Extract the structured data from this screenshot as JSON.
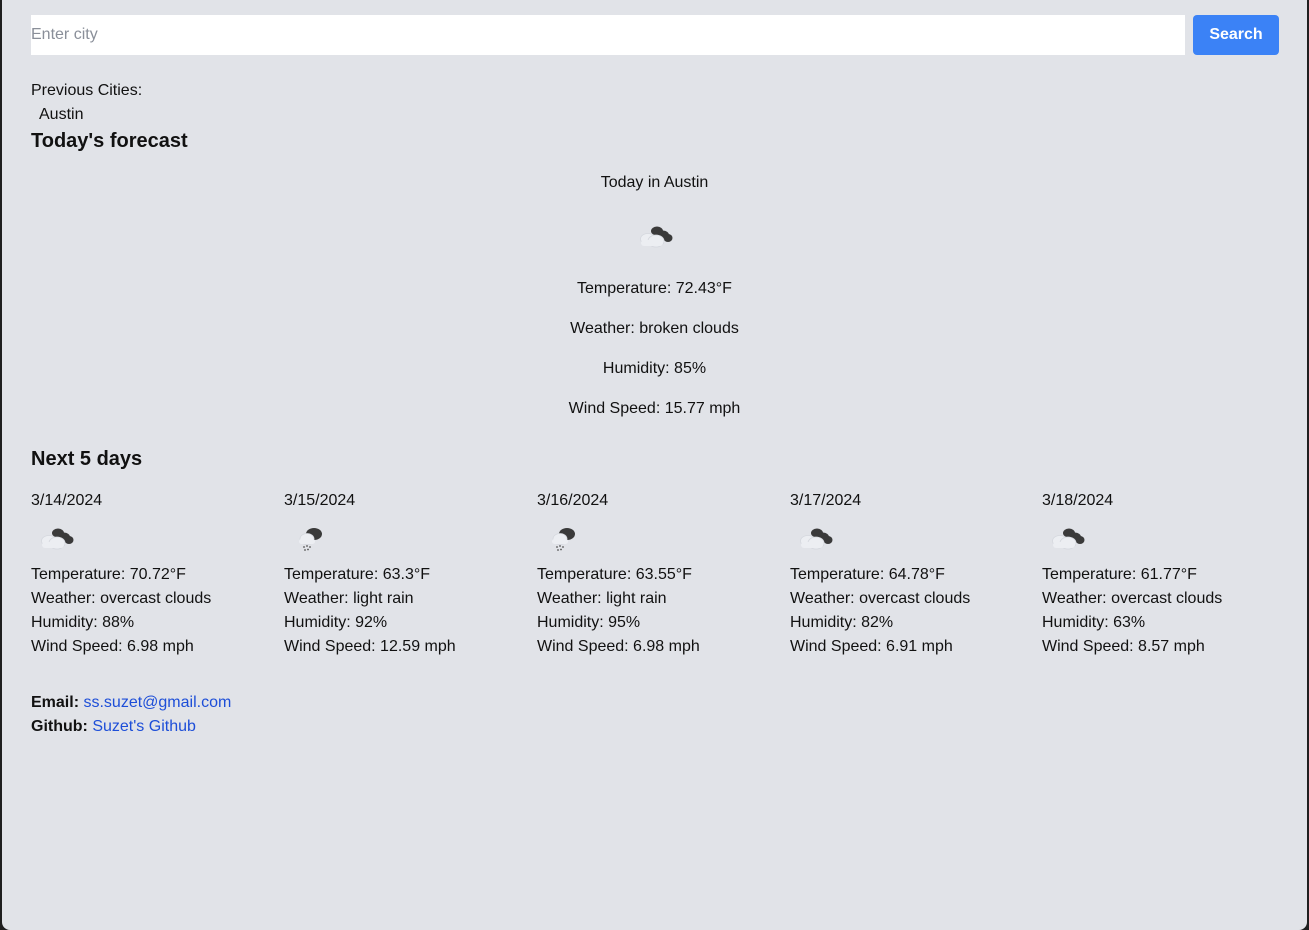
{
  "search": {
    "placeholder": "Enter city",
    "value": "",
    "button_label": "Search"
  },
  "history": {
    "label": "Previous Cities:",
    "cities": [
      "Austin"
    ]
  },
  "today": {
    "heading": "Today's forecast",
    "title": "Today in Austin",
    "icon": "broken-clouds-icon",
    "temperature": "Temperature: 72.43°F",
    "weather": "Weather: broken clouds",
    "humidity": "Humidity: 85%",
    "wind": "Wind Speed: 15.77 mph"
  },
  "next": {
    "heading": "Next 5 days",
    "days": [
      {
        "date": "3/14/2024",
        "icon": "overcast-clouds-icon",
        "temperature": "Temperature: 70.72°F",
        "weather": "Weather: overcast clouds",
        "humidity": "Humidity: 88%",
        "wind": "Wind Speed: 6.98 mph"
      },
      {
        "date": "3/15/2024",
        "icon": "light-rain-icon",
        "temperature": "Temperature: 63.3°F",
        "weather": "Weather: light rain",
        "humidity": "Humidity: 92%",
        "wind": "Wind Speed: 12.59 mph"
      },
      {
        "date": "3/16/2024",
        "icon": "light-rain-icon",
        "temperature": "Temperature: 63.55°F",
        "weather": "Weather: light rain",
        "humidity": "Humidity: 95%",
        "wind": "Wind Speed: 6.98 mph"
      },
      {
        "date": "3/17/2024",
        "icon": "overcast-clouds-icon",
        "temperature": "Temperature: 64.78°F",
        "weather": "Weather: overcast clouds",
        "humidity": "Humidity: 82%",
        "wind": "Wind Speed: 6.91 mph"
      },
      {
        "date": "3/18/2024",
        "icon": "overcast-clouds-icon",
        "temperature": "Temperature: 61.77°F",
        "weather": "Weather: overcast clouds",
        "humidity": "Humidity: 63%",
        "wind": "Wind Speed: 8.57 mph"
      }
    ]
  },
  "contact": {
    "email_label": "Email:",
    "email": "ss.suzet@gmail.com",
    "github_label": "Github:",
    "github_link": "Suzet's Github"
  },
  "colors": {
    "background": "#e1e3e8",
    "button": "#3b82f6",
    "link": "#1d4ed8"
  }
}
